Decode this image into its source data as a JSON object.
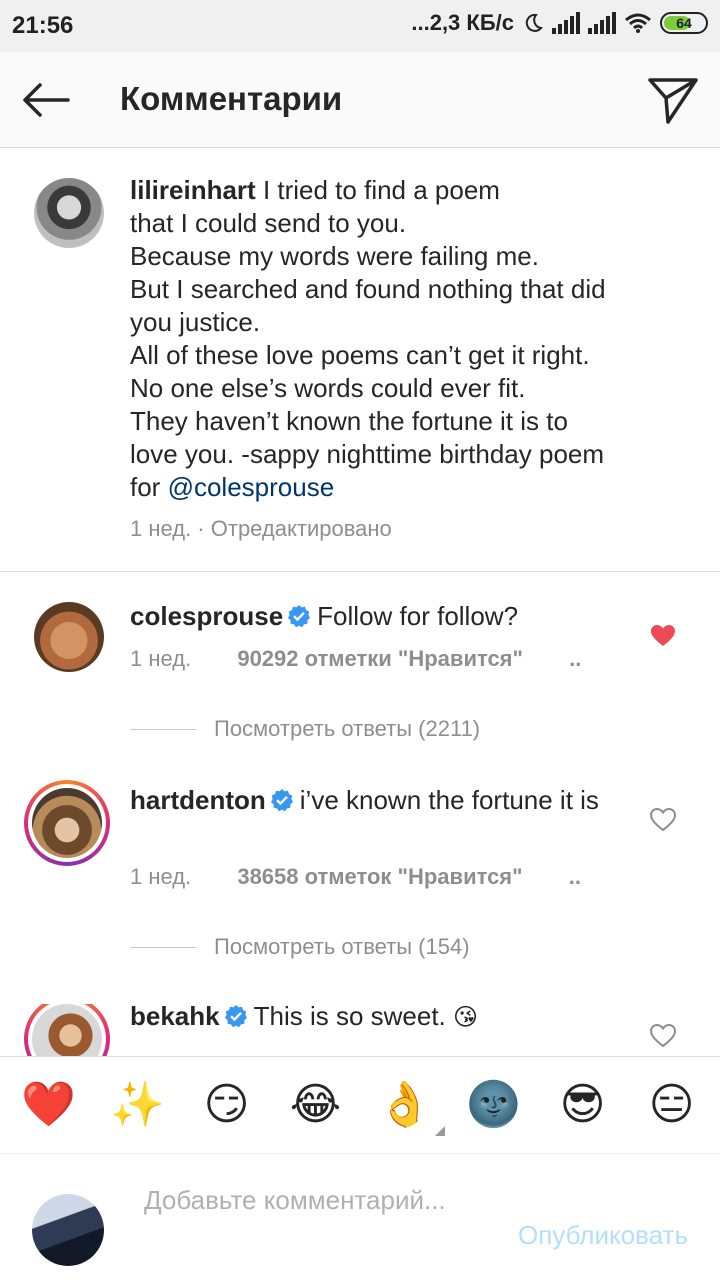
{
  "status_bar": {
    "time": "21:56",
    "speed": "...2,3 КБ/с",
    "battery": "64"
  },
  "header": {
    "title": "Комментарии"
  },
  "caption": {
    "username": "lilireinhart",
    "lines": [
      "I tried to find a poem",
      "that I could send to you.",
      "Because my words were failing me.",
      "But I searched and found nothing that did",
      "you justice.",
      "All of these love poems can’t get it right.",
      "No one else’s words could ever fit.",
      "They haven’t known the fortune it is to",
      "love you. -sappy nighttime birthday poem"
    ],
    "last_line_prefix": "for",
    "mention": "@colesprouse",
    "meta": "1 нед. · Отредактировано"
  },
  "comments": [
    {
      "username": "colesprouse",
      "text": "Follow for follow?",
      "time": "1 нед.",
      "likes": "90292 отметки \"Нравится\"",
      "more": "..",
      "replies": "Посмотреть ответы (2211)",
      "liked": true
    },
    {
      "username": "hartdenton",
      "text": "i’ve known the fortune it is",
      "time": "1 нед.",
      "likes": "38658 отметок \"Нравится\"",
      "more": "..",
      "replies": "Посмотреть ответы (154)",
      "liked": false
    },
    {
      "username": "bekahk",
      "text": "This is so sweet.",
      "emoji": "😘",
      "liked": false
    }
  ],
  "emoji_bar": [
    "❤️",
    "✨",
    "😏",
    "😂",
    "👌",
    "🌚",
    "😎",
    "😑"
  ],
  "input": {
    "placeholder": "Добавьте комментарий...",
    "publish": "Опубликовать"
  },
  "colors": {
    "liked_heart": "#ed4956",
    "mention": "#00376b",
    "verified": "#3897f0",
    "publish_disabled": "#b2dffc"
  }
}
